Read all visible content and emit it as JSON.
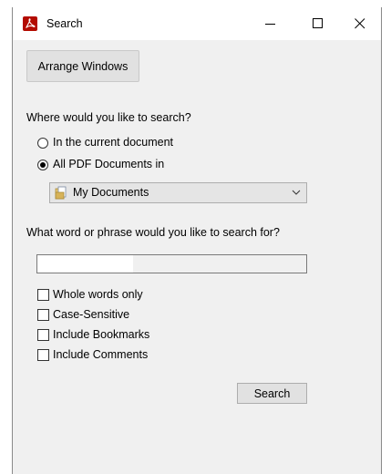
{
  "window": {
    "title": "Search",
    "icon": "acrobat-pdf-icon",
    "controls": {
      "minimize": "minimize-icon",
      "maximize": "maximize-icon",
      "close": "close-icon"
    }
  },
  "toolbar": {
    "arrange_label": "Arrange Windows"
  },
  "where": {
    "label": "Where would you like to search?",
    "options": [
      {
        "label": "In the current document",
        "checked": false
      },
      {
        "label": "All PDF Documents in",
        "checked": true
      }
    ],
    "location": {
      "value": "My Documents",
      "icon": "documents-folder-icon"
    }
  },
  "phrase": {
    "label": "What word or phrase would you like to search for?",
    "value": ""
  },
  "options": [
    {
      "label": "Whole words only",
      "checked": false
    },
    {
      "label": "Case-Sensitive",
      "checked": false
    },
    {
      "label": "Include Bookmarks",
      "checked": false
    },
    {
      "label": "Include Comments",
      "checked": false
    }
  ],
  "actions": {
    "search_label": "Search"
  }
}
